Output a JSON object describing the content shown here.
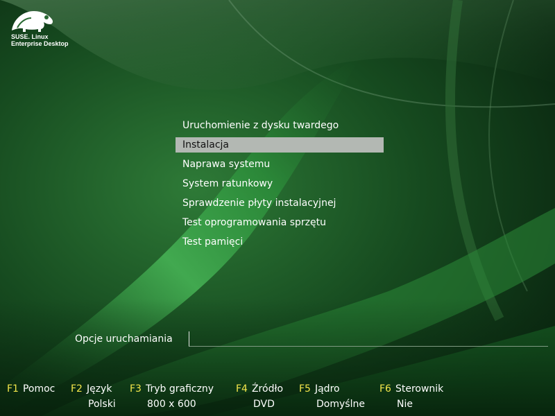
{
  "logo": {
    "line1": "SUSE. Linux",
    "line2": "Enterprise Desktop",
    "icon": "chameleon-icon"
  },
  "menu": {
    "items": [
      {
        "label": "Uruchomienie z dysku twardego",
        "selected": false
      },
      {
        "label": "Instalacja",
        "selected": true
      },
      {
        "label": "Naprawa systemu",
        "selected": false
      },
      {
        "label": "System ratunkowy",
        "selected": false
      },
      {
        "label": "Sprawdzenie płyty instalacyjnej",
        "selected": false
      },
      {
        "label": "Test oprogramowania sprzętu",
        "selected": false
      },
      {
        "label": "Test pamięci",
        "selected": false
      }
    ]
  },
  "boot_options": {
    "label": "Opcje uruchamiania",
    "value": ""
  },
  "fkeys": [
    {
      "key": "F1",
      "name": "Pomoc",
      "value": ""
    },
    {
      "key": "F2",
      "name": "Język",
      "value": "Polski"
    },
    {
      "key": "F3",
      "name": "Tryb graficzny",
      "value": "800 x 600"
    },
    {
      "key": "F4",
      "name": "Źródło",
      "value": "DVD"
    },
    {
      "key": "F5",
      "name": "Jądro",
      "value": "Domyślne"
    },
    {
      "key": "F6",
      "name": "Sterownik",
      "value": "Nie"
    }
  ],
  "colors": {
    "key_accent": "#f3e64a",
    "selection": "#b3b8b3",
    "background_dark": "#0b2a12",
    "background_green": "#2f8a3e"
  }
}
